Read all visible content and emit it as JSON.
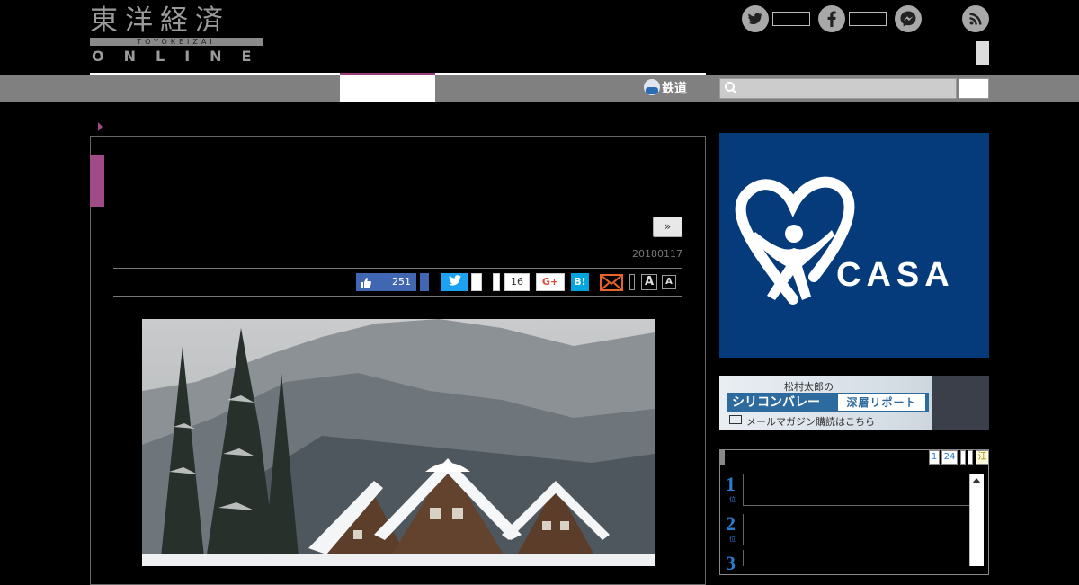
{
  "header": {
    "logo_kanji": "東洋経済",
    "logo_sub": "TOYOKEIZAI",
    "logo_online": "ONLINE"
  },
  "social": {
    "twitter_icon": "twitter-icon",
    "facebook_icon": "facebook-icon",
    "messenger_icon": "messenger-icon",
    "rss_icon": "rss-icon"
  },
  "nav": {
    "tetsudo_label": "鉄道",
    "search_placeholder": ""
  },
  "article": {
    "next_label": "»",
    "date": "20180117",
    "share": {
      "like_count": "251",
      "hatena_count": "16",
      "gplus_label": "G+",
      "hatena_label": "B!",
      "font_large": "A",
      "font_small": "A"
    }
  },
  "sidebar": {
    "casa_label": "CASA",
    "casa_reg": "®",
    "mag_line1": "松村太郎の",
    "mag_title": "シリコンバレー",
    "mag_title2": "深層リポート",
    "mag_line3": "メールマガジン購読はこちら",
    "ranking": {
      "tabs": [
        "1",
        "24",
        "",
        "",
        "江"
      ],
      "ranks": [
        "1",
        "2",
        "3"
      ],
      "rank_suffix": "位"
    }
  },
  "colors": {
    "accent": "#9b3f7c",
    "nav_gray": "#808080",
    "facebook_blue": "#4267b2",
    "twitter_blue": "#1da1f2",
    "hatena_blue": "#00a4de",
    "casa_navy": "#053b7a",
    "rank_blue": "#2a7cd0"
  }
}
